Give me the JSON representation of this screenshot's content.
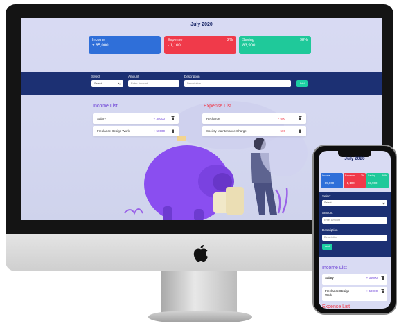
{
  "app": {
    "title": "July 2020"
  },
  "summary": {
    "income": {
      "label": "Income",
      "value": "+ 85,000",
      "color": "#2f6fd9"
    },
    "expense": {
      "label": "Expense",
      "percent": "2%",
      "value": "- 1,100",
      "color": "#f03a4a"
    },
    "saving": {
      "label": "Saving",
      "percent": "98%",
      "value": "83,900",
      "color": "#1fc99a"
    }
  },
  "form": {
    "select_label": "Select",
    "select_value": "Select",
    "amount_label": "Amount",
    "amount_placeholder": "Enter Amount",
    "description_label": "Description",
    "description_placeholder": "Description",
    "add_label": "Add"
  },
  "income_list": {
    "title": "Income List",
    "color": "#6b3fd6",
    "items": [
      {
        "title": "Salary",
        "amount": "+ 35000"
      },
      {
        "title": "Freelance Design Work",
        "amount": "+ 50000"
      }
    ]
  },
  "expense_list": {
    "title": "Expense List",
    "color": "#f03a4a",
    "items": [
      {
        "title": "Recharge",
        "amount": "- 600"
      },
      {
        "title": "Society Maintenance Charge",
        "amount": "- 500"
      }
    ]
  },
  "icons": {
    "delete": "trash-icon",
    "brand": "apple-logo-icon",
    "select": "chevron-down-icon"
  }
}
